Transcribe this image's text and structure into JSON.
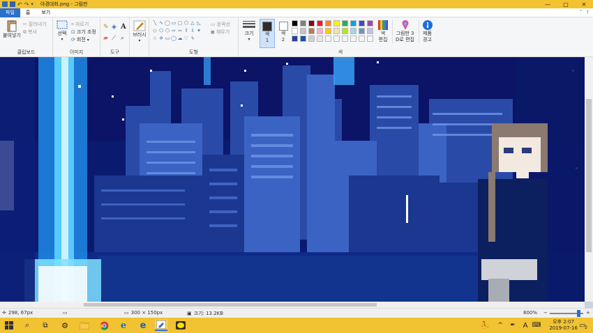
{
  "window": {
    "title": "야경대회.png - 그림판",
    "controls": [
      "—",
      "□",
      "✕"
    ]
  },
  "tabs": [
    {
      "label": "파일"
    },
    {
      "label": "홈"
    },
    {
      "label": "보기"
    }
  ],
  "ribbon": {
    "clipboard": {
      "paste": "붙여넣기",
      "cut": "잘라내기",
      "copy": "복사",
      "label": "클립보드"
    },
    "image": {
      "select": "선택",
      "crop": "자르기",
      "resize": "크기 조정",
      "rotate": "회전",
      "label": "이미지"
    },
    "tools": {
      "label": "도구"
    },
    "brush": {
      "label": "브러시"
    },
    "shapes": {
      "outline": "윤곽선",
      "fill": "채우기",
      "label": "도형"
    },
    "size": {
      "label": "크기"
    },
    "color1": {
      "label": "색\n1"
    },
    "color2": {
      "label": "색\n2"
    },
    "colors": {
      "label": "색",
      "edit": "색\n편집"
    },
    "paint3d": {
      "label": "그림판 3\nD로 편집"
    },
    "product_alert": {
      "label": "제품\n경고"
    }
  },
  "palette": [
    "#000000",
    "#7f7f7f",
    "#880015",
    "#ed1c24",
    "#ff7f27",
    "#fff200",
    "#22b14c",
    "#00a2e8",
    "#3f48cc",
    "#a349a4",
    "#ffffff",
    "#c3c3c3",
    "#b97a57",
    "#ffaec9",
    "#ffc90e",
    "#efe4b0",
    "#b5e61d",
    "#99d9ea",
    "#7092be",
    "#c8bfe7",
    "#2a3f9e",
    "#1d4fa8",
    "#d0d0d0",
    "#e8e8e8",
    "#f4f4f4",
    "#f4f4f4",
    "#f4f4f4",
    "#f4f4f4",
    "#f4f4f4",
    "#f4f4f4"
  ],
  "status": {
    "cursor_pos": "298, 67px",
    "image_size": "300 × 150px",
    "file_size": "크기: 13.2KB",
    "zoom": "800%"
  },
  "taskbar": {
    "time": "오후 2:07",
    "date": "2019-07-16",
    "lang": "A",
    "notifications": "2"
  },
  "colors": {
    "titlebar": "#f2c230",
    "taskbar": "#f1c232",
    "file_tab": "#2b6fcf",
    "sky": "#0a1a6e"
  }
}
